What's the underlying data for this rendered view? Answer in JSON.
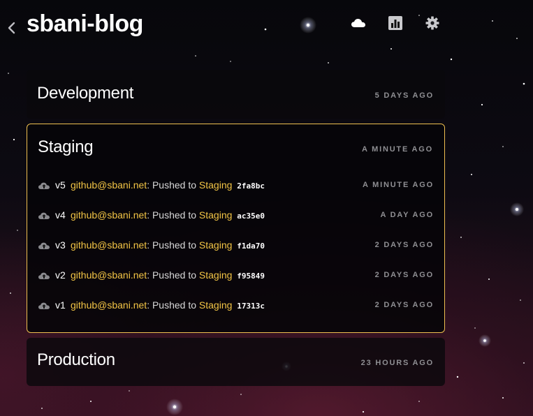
{
  "header": {
    "title": "sbani-blog",
    "icons": [
      "back-chevron-icon",
      "cloud-icon",
      "bar-chart-icon",
      "gear-icon"
    ]
  },
  "colors": {
    "accent": "#f3c545",
    "muted": "#8f8f93",
    "active_border": "#f0c050"
  },
  "environments": [
    {
      "name": "Development",
      "time": "5 DAYS AGO",
      "active": false
    },
    {
      "name": "Staging",
      "time": "A MINUTE AGO",
      "active": true
    },
    {
      "name": "Production",
      "time": "23 HOURS AGO",
      "active": false
    }
  ],
  "staging_releases": [
    {
      "version": "v5",
      "user": "github@sbani.net",
      "action": ": Pushed to ",
      "target": "Staging",
      "sha": "2fa8bc",
      "time": "A MINUTE AGO"
    },
    {
      "version": "v4",
      "user": "github@sbani.net",
      "action": ": Pushed to ",
      "target": "Staging",
      "sha": "ac35e0",
      "time": "A DAY AGO"
    },
    {
      "version": "v3",
      "user": "github@sbani.net",
      "action": ": Pushed to ",
      "target": "Staging",
      "sha": "f1da70",
      "time": "2 DAYS AGO"
    },
    {
      "version": "v2",
      "user": "github@sbani.net",
      "action": ": Pushed to ",
      "target": "Staging",
      "sha": "f95849",
      "time": "2 DAYS AGO"
    },
    {
      "version": "v1",
      "user": "github@sbani.net",
      "action": ": Pushed to ",
      "target": "Staging",
      "sha": "17313c",
      "time": "2 DAYS AGO"
    }
  ]
}
